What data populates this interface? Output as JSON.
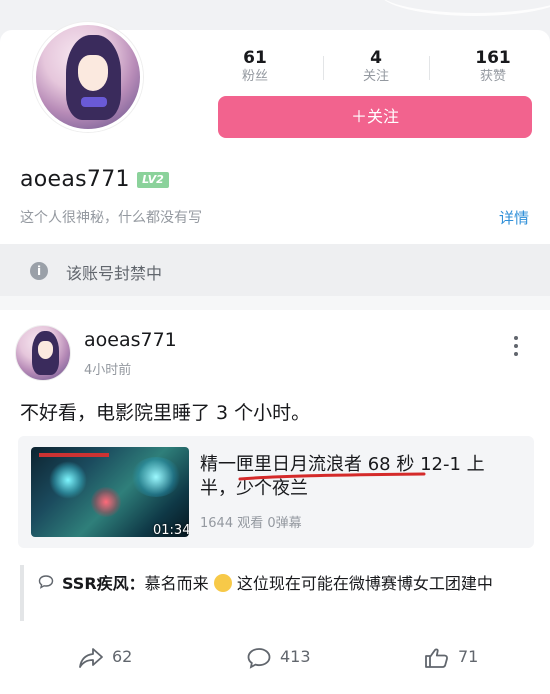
{
  "profile": {
    "stats": [
      {
        "num": "61",
        "label": "粉丝"
      },
      {
        "num": "4",
        "label": "关注"
      },
      {
        "num": "161",
        "label": "获赞"
      }
    ],
    "follow_label": "＋关注",
    "username": "aoeas771",
    "level": "LV2",
    "bio": "这个人很神秘，什么都没有写",
    "detail_link": "详情"
  },
  "ban_notice": {
    "icon": "info-icon",
    "text": "该账号封禁中"
  },
  "post": {
    "author": "aoeas771",
    "time": "4小时前",
    "text": "不好看，电影院里睡了 3 个小时。",
    "video": {
      "title": "精一匣里日月流浪者 68 秒 12-1 上半，少个夜兰",
      "duration": "01:34",
      "meta": "1644 观看  0弹幕"
    },
    "comment": {
      "author": "SSR疾风：",
      "text": "慕名而来",
      "text_after": " 这位现在可能在微博赛博女工团建中"
    },
    "actions": {
      "share": "62",
      "comment": "413",
      "like": "71"
    }
  },
  "colors": {
    "accent": "#f2638e",
    "link": "#2f8fd8",
    "level_badge": "#8bd29b",
    "underline": "#d42a2a"
  }
}
